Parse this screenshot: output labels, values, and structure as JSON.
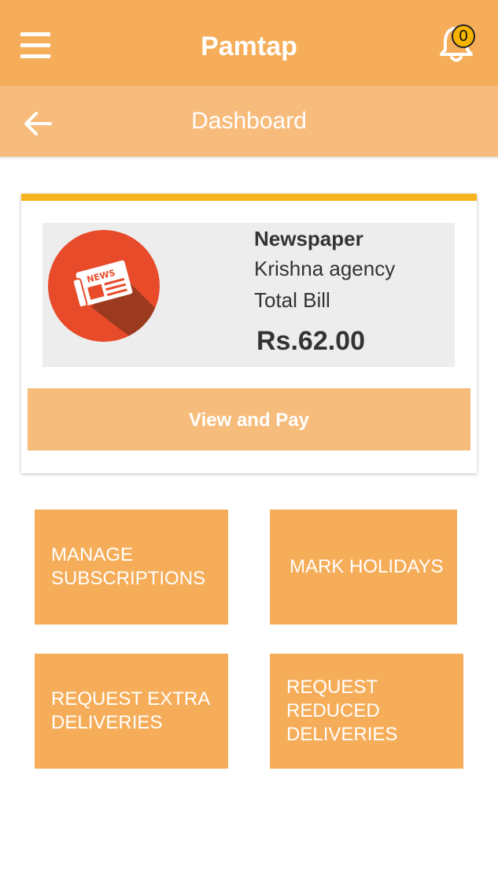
{
  "app": {
    "title": "Pamtap",
    "notification_count": "0",
    "menu_icon": "hamburger-icon",
    "notification_icon": "bell-icon"
  },
  "subheader": {
    "title": "Dashboard",
    "back_icon": "arrow-left-icon"
  },
  "bill_card": {
    "category": "Newspaper",
    "agency": "Krishna agency",
    "label": "Total Bill",
    "amount": "Rs.62.00",
    "logo_text": "NEWS",
    "button_label": "View and Pay"
  },
  "actions": [
    {
      "label": "MANAGE SUBSCRIPTIONS"
    },
    {
      "label": "MARK HOLIDAYS"
    },
    {
      "label": "REQUEST EXTRA DELIVERIES"
    },
    {
      "label": "REQUEST REDUCED DELIVERIES"
    }
  ],
  "colors": {
    "primary": "#f6ad59",
    "primary_light": "#f7bc7c",
    "card_accent": "#f6b31e",
    "logo_red": "#e84b2a"
  }
}
